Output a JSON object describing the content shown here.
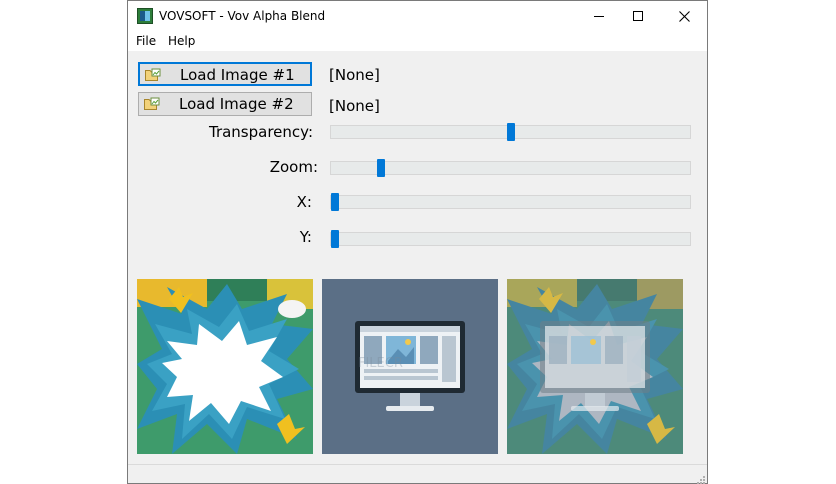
{
  "window": {
    "title": "VOVSOFT - Vov Alpha Blend",
    "app_icon": "app-icon",
    "controls": [
      "minimize-icon",
      "maximize-icon",
      "close-icon"
    ]
  },
  "menu": {
    "file": "File",
    "help": "Help"
  },
  "images": {
    "load1_label": "Load Image #1",
    "load2_label": "Load Image #2",
    "path1": "[None]",
    "path2": "[None]",
    "button_icon": "folder-image-icon"
  },
  "sliders": {
    "transparency_label": "Transparency:",
    "zoom_label": "Zoom:",
    "x_label": "X:",
    "y_label": "Y:",
    "transparency_value": 0.5,
    "zoom_value": 0.13,
    "x_value": 0.0,
    "y_value": 0.0
  },
  "colors": {
    "accent": "#0078d7",
    "comic_teal": "#3aa1c4",
    "comic_green": "#3e9b6b",
    "comic_yellow": "#e8b92d",
    "panel_slate": "#5b6f86"
  },
  "previews": [
    "preview-image-1",
    "preview-image-2",
    "preview-blended"
  ]
}
